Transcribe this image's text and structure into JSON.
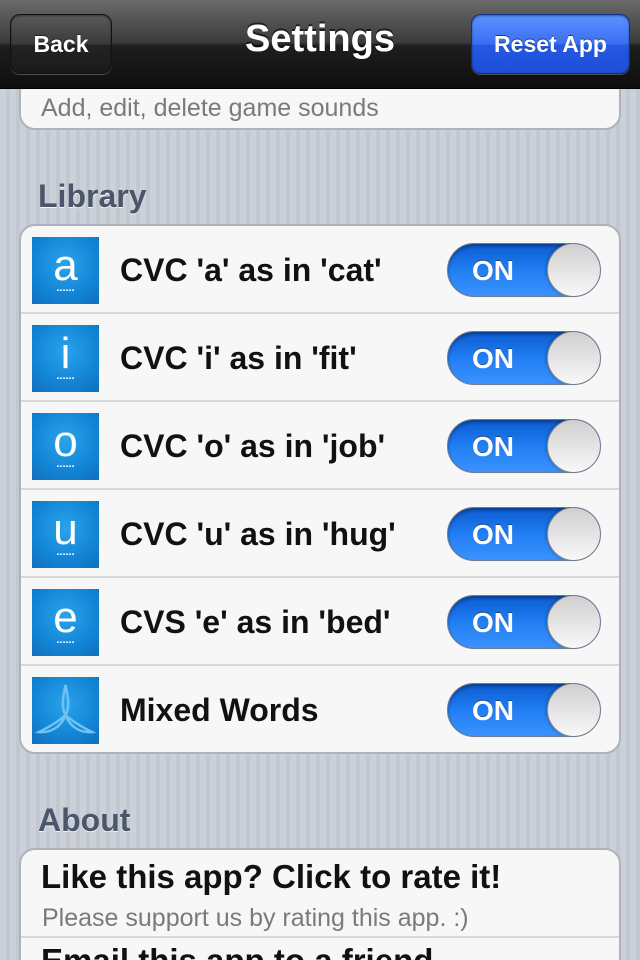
{
  "nav": {
    "title": "Settings",
    "back_label": "Back",
    "reset_label": "Reset App"
  },
  "sounds": {
    "subtitle": "Add, edit, delete game sounds"
  },
  "library": {
    "header": "Library",
    "items": [
      {
        "letter": "a",
        "dots": "......",
        "label": "CVC 'a' as in 'cat'",
        "toggle": "ON",
        "icon": "letter-a-icon"
      },
      {
        "letter": "i",
        "dots": "......",
        "label": "CVC 'i' as in 'fit'",
        "toggle": "ON",
        "icon": "letter-i-icon"
      },
      {
        "letter": "o",
        "dots": "......",
        "label": "CVC 'o' as in 'job'",
        "toggle": "ON",
        "icon": "letter-o-icon"
      },
      {
        "letter": "u",
        "dots": "......",
        "label": "CVC 'u' as in 'hug'",
        "toggle": "ON",
        "icon": "letter-u-icon"
      },
      {
        "letter": "e",
        "dots": "......",
        "label": "CVS 'e' as in 'bed'",
        "toggle": "ON",
        "icon": "letter-e-icon"
      },
      {
        "letter": "",
        "dots": "",
        "label": "Mixed Words",
        "toggle": "ON",
        "icon": "app-logo-icon"
      }
    ]
  },
  "about": {
    "header": "About",
    "rate_title": "Like this app? Click to rate it!",
    "rate_subtitle": "Please support us by rating this app. :)",
    "email_title": "Email this app to a friend"
  },
  "colors": {
    "accent": "#1f7bf0",
    "reset_button": "#2f63ea",
    "tile": "#1385d6"
  }
}
